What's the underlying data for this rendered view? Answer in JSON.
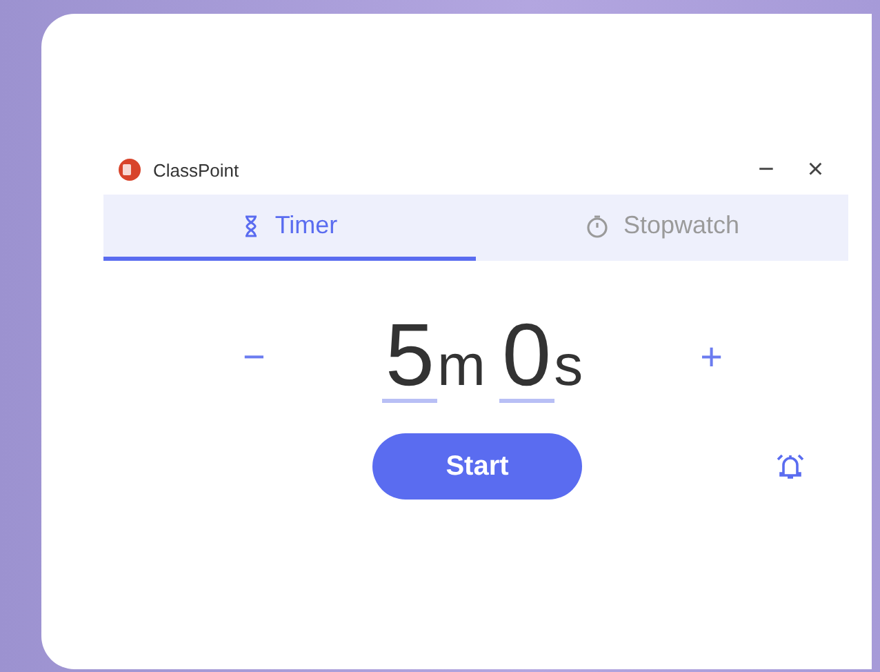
{
  "window": {
    "title": "ClassPoint",
    "controls": [
      "−",
      "×"
    ]
  },
  "tabs": [
    {
      "label": "Timer",
      "kind": "timer",
      "selected": true
    },
    {
      "label": "Stopwatch",
      "kind": "stopwatch",
      "selected": false
    }
  ],
  "timer": {
    "decrement": "−",
    "minutes": "5",
    "minutes_unit": "m",
    "seconds": "0",
    "seconds_unit": "s",
    "increment": "+"
  },
  "start_button": "Start"
}
